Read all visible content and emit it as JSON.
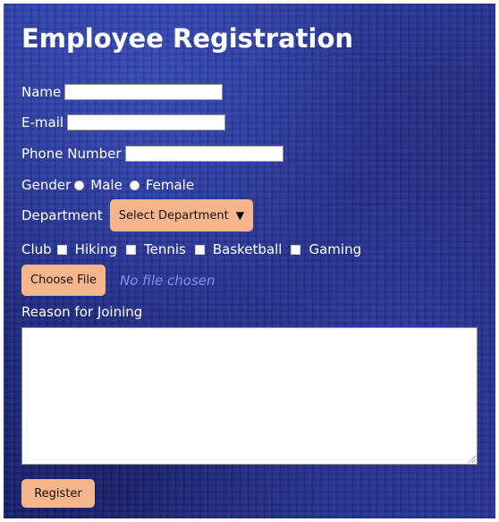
{
  "form": {
    "title": "Employee Registration",
    "name_label": "Name",
    "name_value": "",
    "email_label": "E-mail",
    "email_value": "",
    "phone_label": "Phone Number",
    "phone_value": "",
    "gender_label": "Gender",
    "gender_options": [
      "Male",
      "Female"
    ],
    "department_label": "Department",
    "department_selected": "Select Department",
    "club_label": "Club",
    "club_options": [
      "Hiking",
      "Tennis",
      "Basketball",
      "Gaming"
    ],
    "file_button_label": "Choose File",
    "file_status": "No file chosen",
    "reason_label": "Reason for Joining",
    "reason_value": "",
    "register_label": "Register"
  },
  "colors": {
    "accent": "#f7b58b",
    "background": "#1f2a80",
    "file_status_text": "#8c8cf0"
  },
  "icons": {
    "select_arrow": "caret-down-icon",
    "textarea_resize": "resize-grip-icon"
  }
}
